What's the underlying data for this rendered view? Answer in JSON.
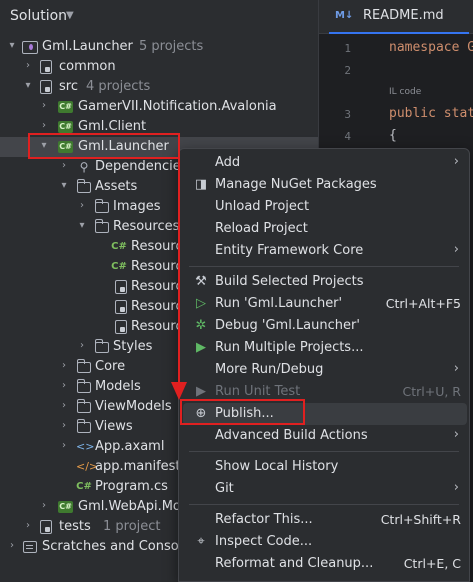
{
  "panel": {
    "title": "Solution",
    "tree": [
      {
        "label": "Gml.Launcher",
        "sub": "5 projects",
        "icon": "solution-icon"
      },
      {
        "label": "common",
        "icon": "lock-folder-icon"
      },
      {
        "label": "src",
        "sub": "4 projects",
        "icon": "lock-folder-icon"
      },
      {
        "label": "GamerVII.Notification.Avalonia",
        "icon": "csharp-project-icon"
      },
      {
        "label": "Gml.Client",
        "icon": "csharp-project-icon"
      },
      {
        "label": "Gml.Launcher",
        "icon": "csharp-project-icon"
      },
      {
        "label": "Dependencies",
        "icon": "dependencies-icon"
      },
      {
        "label": "Assets",
        "icon": "folder-icon"
      },
      {
        "label": "Images",
        "icon": "folder-icon"
      },
      {
        "label": "Resources",
        "icon": "folder-icon"
      },
      {
        "label": "Resourc",
        "icon": "csharp-file-icon"
      },
      {
        "label": "Resourc",
        "icon": "csharp-file-icon"
      },
      {
        "label": "Resourc",
        "icon": "resource-file-icon"
      },
      {
        "label": "Resourc",
        "icon": "resource-file-icon"
      },
      {
        "label": "Resourc",
        "icon": "resource-file-icon"
      },
      {
        "label": "Styles",
        "icon": "folder-icon"
      },
      {
        "label": "Core",
        "icon": "folder-icon"
      },
      {
        "label": "Models",
        "icon": "folder-icon"
      },
      {
        "label": "ViewModels",
        "icon": "folder-icon"
      },
      {
        "label": "Views",
        "icon": "folder-icon"
      },
      {
        "label": "App.axaml",
        "icon": "axaml-file-icon"
      },
      {
        "label": "app.manifest",
        "icon": "manifest-file-icon"
      },
      {
        "label": "Program.cs",
        "icon": "csharp-file-icon"
      },
      {
        "label": "Gml.WebApi.Mo",
        "icon": "csharp-project-icon"
      },
      {
        "label": "tests",
        "sub": "1 project",
        "icon": "lock-folder-icon"
      },
      {
        "label": "Scratches and Consol",
        "icon": "scratches-icon"
      }
    ]
  },
  "editor": {
    "tab_icon": "M↓",
    "tab_label": "README.md",
    "line_numbers": [
      "1",
      "2",
      "3",
      "4",
      "5"
    ],
    "line1": "namespace G",
    "hint": "IL code",
    "line3_kw": "public stat",
    "line4": "{"
  },
  "menu": {
    "items": [
      {
        "label": "Add",
        "submenu": true
      },
      {
        "label": "Manage NuGet Packages",
        "icon": "nuget-icon"
      },
      {
        "label": "Unload Project"
      },
      {
        "label": "Reload Project"
      },
      {
        "label": "Entity Framework Core",
        "submenu": true
      },
      {
        "label": "Build Selected Projects",
        "icon": "hammer-icon"
      },
      {
        "label": "Run 'Gml.Launcher'",
        "shortcut": "Ctrl+Alt+F5",
        "icon": "run-icon"
      },
      {
        "label": "Debug 'Gml.Launcher'",
        "icon": "debug-icon"
      },
      {
        "label": "Run Multiple Projects...",
        "icon": "run-multiple-icon"
      },
      {
        "label": "More Run/Debug",
        "submenu": true
      },
      {
        "label": "Run Unit Test",
        "shortcut": "Ctrl+U, R",
        "icon": "run-test-icon",
        "disabled": true
      },
      {
        "label": "Publish...",
        "icon": "globe-icon"
      },
      {
        "label": "Advanced Build Actions",
        "submenu": true
      },
      {
        "label": "Show Local History"
      },
      {
        "label": "Git",
        "submenu": true
      },
      {
        "label": "Refactor This...",
        "shortcut": "Ctrl+Shift+R"
      },
      {
        "label": "Inspect Code...",
        "icon": "inspect-icon"
      },
      {
        "label": "Reformat and Cleanup...",
        "shortcut": "Ctrl+E, C"
      }
    ]
  },
  "colors": {
    "annotation": "#e02020",
    "accent": "#3574f0"
  }
}
